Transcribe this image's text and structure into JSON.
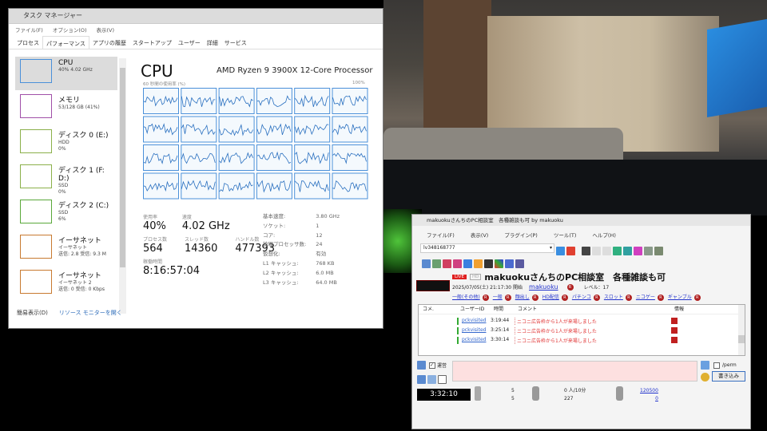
{
  "task_manager": {
    "title": "タスク マネージャー",
    "menu": [
      "ファイル(F)",
      "オプション(O)",
      "表示(V)"
    ],
    "tabs": [
      "プロセス",
      "パフォーマンス",
      "アプリの履歴",
      "スタートアップ",
      "ユーザー",
      "詳細",
      "サービス"
    ],
    "active_tab": "パフォーマンス",
    "sidebar": [
      {
        "name": "CPU",
        "l1": "40% 4.02 GHz",
        "l2": "",
        "color": "#4a90d9"
      },
      {
        "name": "メモリ",
        "l1": "53/128 GB (41%)",
        "l2": "",
        "color": "#a050a8"
      },
      {
        "name": "ディスク 0 (E:)",
        "l1": "HDD",
        "l2": "0%",
        "color": "#8bb04a"
      },
      {
        "name": "ディスク 1 (F: D:)",
        "l1": "SSD",
        "l2": "0%",
        "color": "#8bb04a"
      },
      {
        "name": "ディスク 2 (C:)",
        "l1": "SSD",
        "l2": "6%",
        "color": "#5aa83a"
      },
      {
        "name": "イーサネット",
        "l1": "イーサネット",
        "l2": "送信: 2.8 受信: 9.3 M",
        "color": "#c87a30"
      },
      {
        "name": "イーサネット",
        "l1": "イーサネット 2",
        "l2": "送信: 0 受信: 0 Kbps",
        "color": "#c87a30"
      }
    ],
    "footer": {
      "less": "簡易表示(D)",
      "monitor": "リソース モニターを開く"
    },
    "cpu": {
      "title": "CPU",
      "processor": "AMD Ryzen 9 3900X 12-Core Processor",
      "graph_label": "60 秒間の使用率 (%)",
      "graph_max": "100%",
      "usage_label": "使用率",
      "usage": "40%",
      "speed_label": "速度",
      "speed": "4.02 GHz",
      "proc_label": "プロセス数",
      "proc": "564",
      "threads_label": "スレッド数",
      "threads": "14360",
      "handles_label": "ハンドル数",
      "handles": "477393",
      "uptime_label": "稼働時間",
      "uptime": "8:16:57:04",
      "specs": [
        [
          "基本速度:",
          "3.80 GHz"
        ],
        [
          "ソケット:",
          "1"
        ],
        [
          "コア:",
          "12"
        ],
        [
          "論理プロセッサ数:",
          "24"
        ],
        [
          "仮想化:",
          "有効"
        ],
        [
          "L1 キャッシュ:",
          "768 KB"
        ],
        [
          "L2 キャッシュ:",
          "6.0 MB"
        ],
        [
          "L3 キャッシュ:",
          "64.0 MB"
        ]
      ]
    }
  },
  "nico": {
    "title": "makuokuさんちのPC相談室　各種雑談も可 by makuoku",
    "menu": [
      "ファイル(F)",
      "表示(V)",
      "プラグイン(P)",
      "ツール(T)",
      "ヘルプ(H)"
    ],
    "live_id": "lv348168777",
    "live_badge": "LIVE",
    "hd_badge": "HD",
    "stream_title": "makuokuさんちのPC相談室　各種雑談も可",
    "start": "2025/07/05(土) 21:17:30 開始",
    "owner": "makuoku",
    "level": "レベル：17",
    "tags": [
      "一般(その他)",
      "一般",
      "顔出し",
      "HD配信",
      "パチンコ",
      "スロット",
      "ニコゲー",
      "ギャンブル"
    ],
    "columns": [
      "コメ.",
      "ユーザーID",
      "時間",
      "コメント",
      "情報"
    ],
    "comments": [
      {
        "user": "pckvisited",
        "time": "3:19:44",
        "text": "ニコニ広告枠から1人が来場しました"
      },
      {
        "user": "pckvisited",
        "time": "3:25:14",
        "text": "ニコニ広告枠から1人が来場しました"
      },
      {
        "user": "pckvisited",
        "time": "3:30:14",
        "text": "ニコニ広告枠から1人が来場しました"
      }
    ],
    "unei_label": "運営",
    "perm_label": "/perm",
    "submit": "書き込み",
    "elapsed": "3:32:10",
    "c1": "5",
    "c2": "5",
    "v1": "0",
    "v2": "227",
    "rate": "人/10分",
    "p1": "120500",
    "p2": "0"
  }
}
